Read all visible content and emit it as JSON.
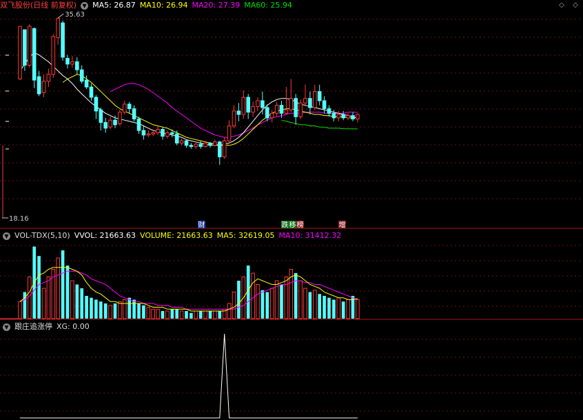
{
  "title": {
    "stock": "双飞股份(日线 前复权)",
    "menu_icon": "chevron-down-icon"
  },
  "main_indicators": [
    {
      "label": "MA5",
      "value": "26.87",
      "color": "#ffffff"
    },
    {
      "label": "MA10",
      "value": "26.94",
      "color": "#ffff00"
    },
    {
      "label": "MA20",
      "value": "27.39",
      "color": "#ff00ff"
    },
    {
      "label": "MA60",
      "value": "25.94",
      "color": "#00e000"
    }
  ],
  "high_label": "35.63",
  "low_label": "18.16",
  "event_badges": [
    {
      "text": "财",
      "bg": "#1a3d9a",
      "fg": "#ffffff"
    },
    {
      "text": "跌",
      "bg": "#0f6e1a",
      "fg": "#ffffff"
    },
    {
      "text": "移",
      "bg": "#0f6e1a",
      "fg": "#ffffff"
    },
    {
      "text": "榜",
      "bg": "#8a1f1f",
      "fg": "#ffffff"
    },
    {
      "text": "增",
      "bg": "#8a1f1f",
      "fg": "#ffffff"
    }
  ],
  "volume_header": {
    "name": "VOL-TDX(5,10)",
    "vvol": "VVOL: 21663.63",
    "volume": "VOLUME: 21663.63",
    "ma5": "MA5: 32619.05",
    "ma10": "MA10: 31412.32"
  },
  "signal_header": {
    "name": "跟庄追涨停",
    "xg": "XG: 0.00"
  },
  "colors": {
    "up": "#ff3a3a",
    "down": "#54ffff",
    "grid": "#7a1010",
    "bg": "#000000"
  },
  "chart_data": [
    {
      "type": "candlestick",
      "ylim": [
        18.16,
        35.63
      ],
      "candles": [
        [
          30.3,
          34.9,
          34.9,
          30.2
        ],
        [
          34.6,
          31.5,
          34.6,
          31.0
        ],
        [
          31.5,
          34.9,
          35.1,
          31.3
        ],
        [
          34.7,
          30.2,
          34.8,
          29.5
        ],
        [
          30.5,
          29.0,
          31.0,
          28.8
        ],
        [
          29.1,
          30.1,
          30.7,
          28.7
        ],
        [
          30.1,
          30.7,
          31.2,
          29.6
        ],
        [
          30.7,
          34.0,
          34.2,
          30.4
        ],
        [
          33.9,
          35.6,
          35.63,
          33.3
        ],
        [
          35.2,
          32.2,
          35.4,
          31.9
        ],
        [
          32.1,
          31.6,
          32.4,
          31.2
        ],
        [
          31.6,
          31.8,
          32.3,
          31.3
        ],
        [
          31.8,
          31.1,
          32.2,
          30.7
        ],
        [
          31.1,
          30.1,
          31.5,
          29.9
        ],
        [
          30.2,
          29.6,
          30.6,
          29.4
        ],
        [
          29.6,
          28.7,
          29.9,
          28.4
        ],
        [
          28.7,
          27.5,
          28.9,
          26.8
        ],
        [
          27.6,
          26.5,
          27.8,
          25.8
        ],
        [
          26.5,
          26.0,
          26.9,
          25.6
        ],
        [
          26.1,
          26.7,
          27.0,
          25.9
        ],
        [
          26.7,
          26.3,
          27.1,
          26.0
        ],
        [
          26.4,
          27.4,
          27.6,
          26.2
        ],
        [
          27.4,
          28.1,
          28.4,
          27.2
        ],
        [
          28.1,
          27.7,
          28.3,
          27.3
        ],
        [
          27.7,
          26.8,
          28.0,
          26.6
        ],
        [
          26.8,
          25.8,
          27.0,
          25.5
        ],
        [
          25.8,
          25.4,
          26.2,
          25.0
        ],
        [
          25.4,
          25.5,
          25.8,
          25.2
        ],
        [
          25.5,
          25.6,
          25.9,
          25.3
        ],
        [
          25.6,
          25.9,
          26.2,
          25.4
        ],
        [
          25.9,
          25.3,
          26.1,
          25.0
        ],
        [
          25.3,
          25.6,
          25.8,
          25.1
        ],
        [
          25.6,
          25.5,
          25.9,
          25.2
        ],
        [
          25.5,
          24.7,
          25.8,
          24.5
        ],
        [
          24.7,
          24.9,
          25.1,
          24.5
        ],
        [
          24.9,
          24.5,
          25.0,
          24.3
        ],
        [
          24.5,
          24.4,
          24.7,
          24.2
        ],
        [
          24.4,
          24.6,
          24.8,
          24.2
        ],
        [
          24.6,
          24.4,
          24.9,
          24.2
        ],
        [
          24.4,
          24.7,
          24.9,
          24.3
        ],
        [
          24.7,
          24.5,
          24.8,
          24.3
        ],
        [
          24.5,
          24.8,
          25.0,
          24.4
        ],
        [
          24.8,
          23.5,
          24.9,
          22.8
        ],
        [
          23.5,
          24.9,
          25.2,
          23.3
        ],
        [
          24.9,
          26.2,
          26.7,
          24.7
        ],
        [
          26.2,
          27.5,
          28.0,
          26.0
        ],
        [
          27.5,
          27.2,
          28.2,
          26.6
        ],
        [
          27.2,
          28.7,
          29.3,
          26.8
        ],
        [
          28.7,
          27.4,
          29.0,
          26.8
        ],
        [
          27.4,
          27.9,
          28.3,
          27.0
        ],
        [
          27.9,
          28.4,
          28.7,
          27.5
        ],
        [
          28.4,
          27.8,
          29.2,
          27.2
        ],
        [
          27.8,
          26.9,
          28.1,
          26.6
        ],
        [
          26.9,
          27.3,
          27.6,
          26.5
        ],
        [
          27.3,
          28.0,
          28.3,
          27.0
        ],
        [
          28.0,
          27.3,
          28.4,
          26.9
        ],
        [
          27.3,
          27.6,
          29.6,
          27.2
        ],
        [
          27.6,
          28.6,
          30.3,
          27.4
        ],
        [
          28.6,
          27.0,
          29.0,
          26.3
        ],
        [
          27.0,
          28.2,
          28.5,
          26.8
        ],
        [
          28.2,
          28.6,
          29.8,
          28.0
        ],
        [
          28.6,
          27.8,
          29.2,
          27.2
        ],
        [
          27.8,
          29.2,
          29.8,
          27.6
        ],
        [
          29.2,
          28.4,
          29.8,
          28.0
        ],
        [
          28.4,
          27.7,
          28.8,
          27.3
        ],
        [
          27.7,
          27.3,
          28.0,
          27.0
        ],
        [
          27.3,
          26.9,
          27.6,
          26.6
        ],
        [
          26.9,
          27.2,
          27.5,
          26.6
        ],
        [
          27.2,
          26.9,
          27.5,
          26.7
        ],
        [
          26.9,
          27.1,
          27.3,
          26.7
        ],
        [
          27.1,
          26.8,
          27.4,
          26.6
        ],
        [
          26.8,
          27.2,
          27.3,
          26.5
        ]
      ],
      "ma5": [
        31.0,
        31.6,
        32.2,
        32.6,
        32.4,
        32.1,
        31.8,
        31.4,
        31.0,
        30.6,
        30.3,
        29.9,
        29.4,
        29.0,
        28.6,
        28.2,
        27.9,
        27.6,
        27.3,
        27.1,
        26.9,
        26.8,
        26.7,
        26.6,
        26.5,
        26.4,
        26.2,
        26.0,
        25.8,
        25.7,
        25.6,
        25.5,
        25.4,
        25.3,
        25.2,
        25.0,
        24.9,
        24.8,
        24.7,
        24.6,
        24.5,
        24.5,
        24.5,
        24.6,
        24.7,
        24.9,
        25.2,
        25.6,
        26.1,
        26.6,
        27.1,
        27.6,
        28.0,
        28.3,
        28.5,
        28.6,
        28.6,
        28.5,
        28.3,
        28.1,
        28.0,
        27.9,
        27.8,
        27.7,
        27.6,
        27.5,
        27.4,
        27.3,
        27.2,
        27.1,
        27.0,
        26.87
      ],
      "ma10": [
        null,
        null,
        null,
        null,
        null,
        null,
        null,
        null,
        null,
        30.0,
        30.3,
        30.5,
        30.7,
        30.6,
        30.3,
        30.0,
        29.6,
        29.2,
        28.8,
        28.4,
        28.0,
        27.7,
        27.5,
        27.3,
        27.1,
        26.9,
        26.7,
        26.5,
        26.3,
        26.2,
        26.1,
        26.0,
        25.8,
        25.6,
        25.4,
        25.2,
        25.1,
        25.0,
        24.9,
        24.8,
        24.7,
        24.6,
        24.5,
        24.5,
        24.5,
        24.6,
        24.8,
        25.1,
        25.5,
        25.9,
        26.3,
        26.7,
        27.0,
        27.3,
        27.5,
        27.6,
        27.7,
        27.7,
        27.6,
        27.5,
        27.4,
        27.3,
        27.2,
        27.2,
        27.1,
        27.1,
        27.0,
        27.0,
        27.0,
        26.9,
        26.9,
        26.94
      ],
      "ma20": [
        null,
        null,
        null,
        null,
        null,
        null,
        null,
        null,
        null,
        null,
        null,
        null,
        null,
        null,
        null,
        null,
        null,
        null,
        null,
        29.2,
        29.4,
        29.6,
        29.8,
        29.9,
        29.9,
        29.8,
        29.6,
        29.4,
        29.1,
        28.8,
        28.5,
        28.2,
        27.8,
        27.5,
        27.2,
        26.9,
        26.6,
        26.3,
        26.0,
        25.8,
        25.6,
        25.4,
        25.3,
        25.2,
        25.2,
        25.3,
        25.4,
        25.6,
        25.8,
        26.0,
        26.3,
        26.5,
        26.7,
        26.9,
        27.0,
        27.1,
        27.2,
        27.3,
        27.3,
        27.3,
        27.4,
        27.4,
        27.4,
        27.4,
        27.3,
        27.3,
        27.3,
        27.3,
        27.3,
        27.4,
        27.4,
        27.39
      ],
      "ma60": [
        null,
        null,
        null,
        null,
        null,
        null,
        null,
        null,
        null,
        null,
        null,
        null,
        null,
        null,
        null,
        null,
        null,
        null,
        null,
        null,
        null,
        null,
        null,
        null,
        null,
        null,
        null,
        null,
        null,
        null,
        null,
        null,
        null,
        null,
        null,
        null,
        null,
        null,
        null,
        null,
        null,
        null,
        null,
        null,
        null,
        null,
        null,
        null,
        null,
        null,
        null,
        null,
        null,
        null,
        null,
        26.7,
        26.6,
        26.5,
        26.4,
        26.3,
        26.3,
        26.2,
        26.2,
        26.1,
        26.1,
        26.0,
        26.0,
        26.0,
        25.95,
        25.95,
        25.94,
        25.94
      ]
    },
    {
      "type": "bar",
      "title": "VOL-TDX(5,10)",
      "values": [
        9,
        14,
        22,
        38,
        33,
        16,
        22,
        26,
        32,
        36,
        28,
        20,
        18,
        16,
        12,
        11,
        10,
        9,
        8,
        7,
        8,
        9,
        10,
        11,
        10,
        8,
        7,
        6,
        5,
        5,
        4,
        4,
        5,
        5,
        4,
        4,
        3,
        4,
        4,
        4,
        4,
        4,
        4,
        5,
        8,
        14,
        20,
        22,
        28,
        24,
        18,
        15,
        14,
        16,
        20,
        18,
        22,
        26,
        24,
        20,
        16,
        14,
        15,
        13,
        12,
        11,
        10,
        11,
        9,
        10,
        12,
        10
      ],
      "down": [
        false,
        true,
        false,
        true,
        true,
        false,
        false,
        false,
        false,
        true,
        true,
        false,
        true,
        true,
        true,
        true,
        true,
        true,
        true,
        false,
        true,
        false,
        false,
        true,
        true,
        true,
        true,
        false,
        false,
        false,
        true,
        false,
        true,
        true,
        false,
        true,
        true,
        false,
        true,
        false,
        true,
        false,
        true,
        false,
        false,
        false,
        true,
        false,
        true,
        false,
        false,
        true,
        true,
        false,
        false,
        true,
        false,
        false,
        true,
        false,
        false,
        true,
        false,
        true,
        true,
        true,
        true,
        false,
        true,
        false,
        true,
        false
      ],
      "ma5": [
        9,
        11,
        14,
        19,
        23,
        24,
        26,
        27,
        27,
        27,
        27,
        26,
        25,
        23,
        19,
        16,
        14,
        13,
        11,
        9,
        9,
        8,
        8,
        8,
        8,
        8,
        8,
        7,
        6,
        6,
        6,
        5,
        5,
        5,
        5,
        5,
        4,
        4,
        4,
        4,
        4,
        4,
        4,
        4,
        5,
        6,
        8,
        11,
        15,
        19,
        21,
        20,
        19,
        18,
        18,
        19,
        20,
        22,
        23,
        22,
        20,
        18,
        17,
        16,
        14,
        13,
        12,
        11,
        11,
        10,
        10,
        10.5
      ],
      "ma10": [
        9,
        10,
        12,
        15,
        18,
        19,
        20,
        22,
        23,
        24,
        25,
        25,
        25,
        24,
        23,
        21,
        20,
        19,
        18,
        16,
        14,
        12,
        11,
        10,
        9,
        9,
        8,
        8,
        8,
        7,
        7,
        7,
        6,
        6,
        6,
        5,
        5,
        5,
        5,
        5,
        5,
        5,
        5,
        5,
        5,
        5,
        6,
        7,
        9,
        11,
        13,
        14,
        15,
        16,
        17,
        18,
        18,
        19,
        20,
        20,
        19,
        19,
        18,
        18,
        17,
        16,
        15,
        14,
        13,
        12,
        11,
        10
      ]
    },
    {
      "type": "line",
      "title": "跟庄追涨停",
      "values": [
        0,
        0,
        0,
        0,
        0,
        0,
        0,
        0,
        0,
        0,
        0,
        0,
        0,
        0,
        0,
        0,
        0,
        0,
        0,
        0,
        0,
        0,
        0,
        0,
        0,
        0,
        0,
        0,
        0,
        0,
        0,
        0,
        0,
        0,
        0,
        0,
        0,
        0,
        0,
        0,
        0,
        0,
        0,
        0,
        0,
        0,
        0,
        0,
        0,
        0,
        0,
        0,
        0,
        0,
        0,
        0,
        0,
        0,
        0,
        0,
        0,
        0,
        0,
        0,
        0,
        0,
        0,
        0,
        0,
        0,
        0,
        0
      ],
      "spike_index": 43,
      "spike_value": 1
    }
  ]
}
